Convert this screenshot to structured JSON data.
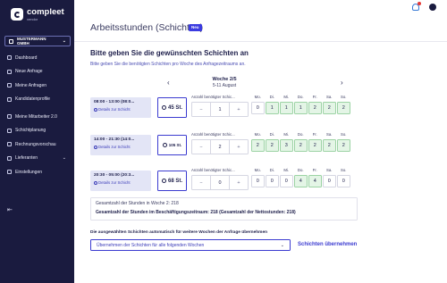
{
  "app": {
    "logo_name": "compleet",
    "logo_sub": "vendor",
    "company": "MUSTERMANN GMBH"
  },
  "sidebar": {
    "items": [
      {
        "label": "Dashboard",
        "icon": "dashboard-icon"
      },
      {
        "label": "Neue Anfrage",
        "icon": "new-request-icon"
      },
      {
        "label": "Meine Anfragen",
        "icon": "requests-icon"
      },
      {
        "label": "Kandidatenprofile",
        "icon": "candidates-icon"
      },
      {
        "label": "Meine Mitarbeiter 2.0",
        "icon": "employees-icon"
      },
      {
        "label": "Schichtplanung",
        "icon": "shift-planning-icon"
      },
      {
        "label": "Rechnungsvorschau",
        "icon": "invoice-icon"
      },
      {
        "label": "Lieferanten",
        "icon": "suppliers-icon",
        "has_chevron": true
      },
      {
        "label": "Einstellungen",
        "icon": "settings-icon"
      }
    ]
  },
  "header": {
    "title": "Arbeitsstunden (Schichten)",
    "badge": "Neu"
  },
  "main": {
    "heading": "Bitte geben Sie die gewünschten Schichten an",
    "subtext": "Bitte geben Sie die benötigten Schichten pro Woche des Anfragezeitraums an.",
    "week": {
      "title": "Woche 2/5",
      "dates": "5-11 August"
    },
    "day_names": [
      "Mo.",
      "Di.",
      "Mi.",
      "Do.",
      "Fr.",
      "Sa.",
      "So."
    ],
    "stepper_label": "Anzahl benötigter Schic...",
    "shifts": [
      {
        "time": "08:00 - 13:00 (08:0...",
        "details": "Details zur Schicht",
        "hours": "45 St.",
        "count": "1",
        "days": [
          "0",
          "1",
          "1",
          "1",
          "2",
          "2",
          "2"
        ],
        "active": [
          false,
          true,
          true,
          true,
          true,
          true,
          true
        ]
      },
      {
        "time": "14:00 - 21:30 (14:0...",
        "details": "Details zur Schicht",
        "hours": "105 St.",
        "count": "2",
        "days": [
          "2",
          "2",
          "3",
          "2",
          "2",
          "2",
          "2"
        ],
        "active": [
          true,
          true,
          true,
          true,
          true,
          true,
          true
        ]
      },
      {
        "time": "20:30 - 05:00 (20:3...",
        "details": "Details zur Schicht",
        "hours": "68 St.",
        "count": "0",
        "days": [
          "0",
          "0",
          "0",
          "4",
          "4",
          "0",
          "0"
        ],
        "active": [
          false,
          false,
          false,
          true,
          true,
          false,
          false
        ]
      }
    ],
    "summary": {
      "line1": "Gesamtzahl der Stunden in Woche 2: 218",
      "line2": "Gesamtzahl der Stunden im Beschäftigungszeitraum: 218 (Gesamtzahl der Nettostunden: 218)"
    },
    "apply": {
      "label": "Die ausgewählten Schichten automatisch für weitere Wochen der Anfrage übernehmen",
      "select_value": "Übernehmen der Schichten für alle folgenden Wochen",
      "button": "Schichten übernehmen"
    }
  },
  "colors": {
    "sidebar": "#1a1b3f",
    "accent": "#3b3bd0",
    "active_day": "#e4f5e6",
    "shift_bg": "#e3e5f6"
  }
}
